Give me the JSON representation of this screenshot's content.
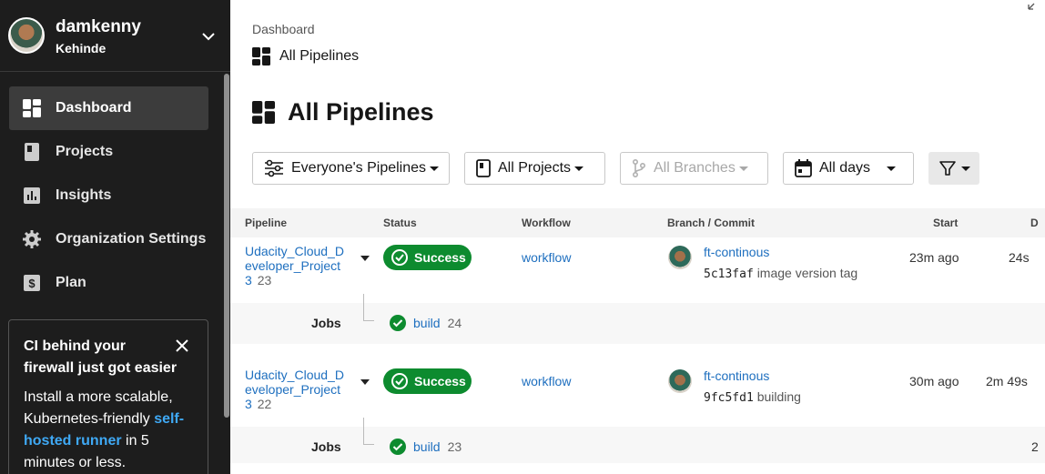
{
  "user": {
    "name": "damkenny",
    "org": "Kehinde"
  },
  "nav": [
    {
      "label": "Dashboard",
      "icon": "dashboard-icon",
      "active": true
    },
    {
      "label": "Projects",
      "icon": "projects-icon",
      "active": false
    },
    {
      "label": "Insights",
      "icon": "insights-icon",
      "active": false
    },
    {
      "label": "Organization Settings",
      "icon": "gear-icon",
      "active": false
    },
    {
      "label": "Plan",
      "icon": "dollar-icon",
      "active": false
    }
  ],
  "promo": {
    "title": "CI behind your firewall just got easier",
    "body_start": "Install a more scalable, Kubernetes-friendly ",
    "link": "self-hosted runner",
    "body_end": " in 5 minutes or less."
  },
  "breadcrumb": {
    "root": "Dashboard",
    "current": "All Pipelines"
  },
  "page_title": "All Pipelines",
  "filters": {
    "pipelines": "Everyone's Pipelines",
    "projects": "All Projects",
    "branches": "All Branches",
    "days": "All days"
  },
  "table": {
    "headers": {
      "pipeline": "Pipeline",
      "status": "Status",
      "workflow": "Workflow",
      "branch": "Branch / Commit",
      "start": "Start",
      "duration": "D"
    },
    "rows": [
      {
        "pipeline": "Udacity_Cloud_Developer_Project3",
        "number": "23",
        "status": "Success",
        "workflow": "workflow",
        "branch": "ft-continous",
        "sha": "5c13faf",
        "message": "image version tag",
        "start": "23m ago",
        "duration": "24s",
        "jobs_label": "Jobs",
        "job": "build",
        "job_number": "24"
      },
      {
        "pipeline": "Udacity_Cloud_Developer_Project3",
        "number": "22",
        "status": "Success",
        "workflow": "workflow",
        "branch": "ft-continous",
        "sha": "9fc5fd1",
        "message": "building",
        "start": "30m ago",
        "duration": "2m 49s",
        "jobs_label": "Jobs",
        "job": "build",
        "job_number": "23",
        "job_trailing": "2"
      }
    ]
  },
  "colors": {
    "sidebar": "#1d1d1d",
    "success": "#0d8b2f",
    "link": "#1e6fbf"
  }
}
